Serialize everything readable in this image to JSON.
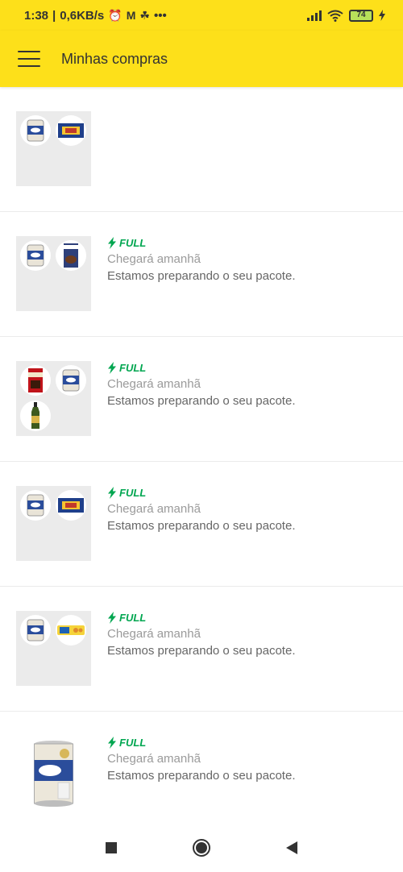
{
  "status_bar": {
    "time": "1:38",
    "net_speed": "0,6KB/s",
    "battery_level": "74"
  },
  "app_bar": {
    "title": "Minhas compras"
  },
  "colors": {
    "brand_yellow": "#fde01a",
    "full_green": "#00a650"
  },
  "purchases": [
    {
      "thumbnails": [
        "condensed-milk-can",
        "chocolate-box"
      ],
      "full_label": "",
      "delivery": "",
      "status": ""
    },
    {
      "thumbnails": [
        "condensed-milk-can",
        "cocoa-powder-box"
      ],
      "full_label": "FULL",
      "delivery": "Chegará amanhã",
      "status": "Estamos preparando o seu pacote."
    },
    {
      "thumbnails": [
        "coffee-pack",
        "condensed-milk-can",
        "olive-oil-bottle"
      ],
      "full_label": "FULL",
      "delivery": "Chegará amanhã",
      "status": "Estamos preparando o seu pacote."
    },
    {
      "thumbnails": [
        "condensed-milk-can",
        "chocolate-box"
      ],
      "full_label": "FULL",
      "delivery": "Chegará amanhã",
      "status": "Estamos preparando o seu pacote."
    },
    {
      "thumbnails": [
        "condensed-milk-can",
        "cracker-pack"
      ],
      "full_label": "FULL",
      "delivery": "Chegará amanhã",
      "status": "Estamos preparando o seu pacote."
    },
    {
      "thumbnails": [
        "condensed-milk-can"
      ],
      "full_label": "FULL",
      "delivery": "Chegará amanhã",
      "status": "Estamos preparando o seu pacote."
    }
  ],
  "nav_bar": {
    "buttons": [
      "recents-square-icon",
      "home-circle-icon",
      "back-triangle-icon"
    ]
  }
}
